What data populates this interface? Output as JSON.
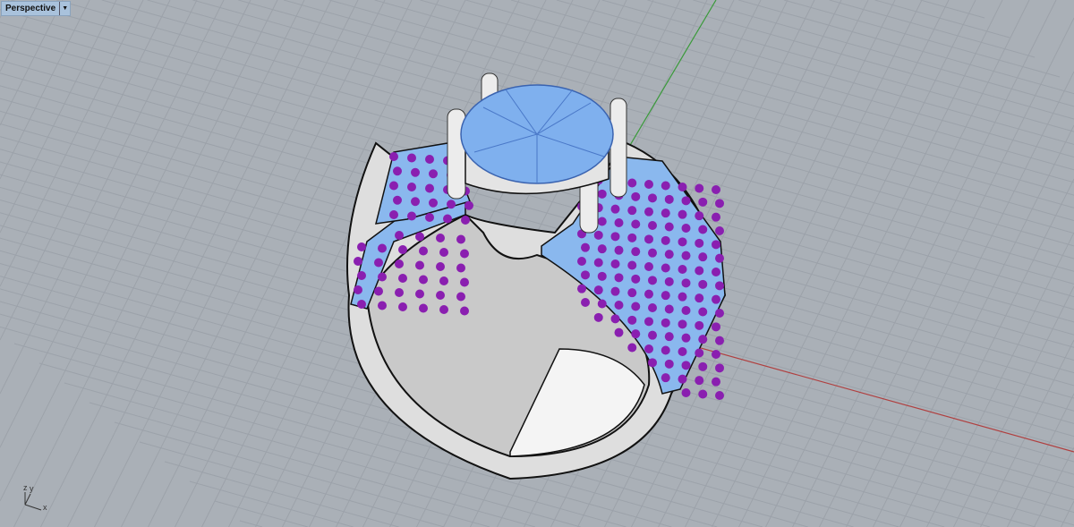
{
  "viewport": {
    "name": "Perspective",
    "dropdown_icon": "triangle-down-icon",
    "axes": {
      "x": "x",
      "y": "y",
      "z": "z"
    }
  },
  "colors": {
    "background": "#aab0b7",
    "grid": "#9ca2aa",
    "x_axis": "#b04040",
    "y_axis": "#3a9a3a",
    "metal": "#e8e8e8",
    "gem": "#7fb0ee",
    "pave_stones": "#8a1fb0"
  }
}
